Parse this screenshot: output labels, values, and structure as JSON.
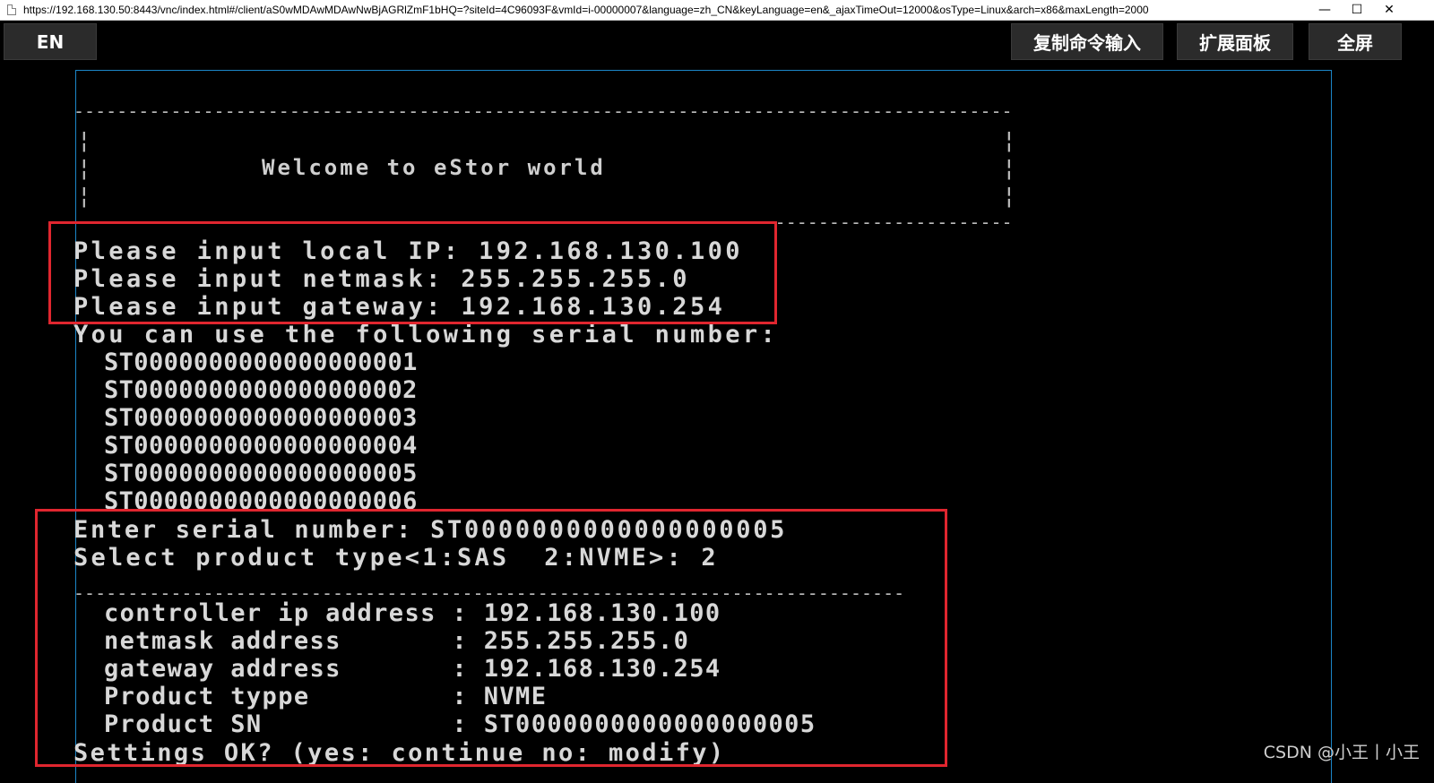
{
  "browser": {
    "url": "https://192.168.130.50:8443/vnc/index.html#/client/aS0wMDAwMDAwNwBjAGRlZmF1bHQ=?siteId=4C96093F&vmId=i-00000007&language=zh_CN&keyLanguage=en&_ajaxTimeOut=12000&osType=Linux&arch=x86&maxLength=2000",
    "minimize": "—",
    "maximize": "☐",
    "close": "✕"
  },
  "toolbar": {
    "language_label": "EN",
    "copy_command_label": "复制命令输入",
    "extend_panel_label": "扩展面板",
    "fullscreen_label": "全屏"
  },
  "console": {
    "welcome": "Welcome to eStor world",
    "ip_line": "Please input local IP: 192.168.130.100",
    "netmask_line": "Please input netmask: 255.255.255.0",
    "gateway_line": "Please input gateway: 192.168.130.254",
    "serial_intro": "You can use the following serial number:",
    "serials": [
      "ST0000000000000000001",
      "ST0000000000000000002",
      "ST0000000000000000003",
      "ST0000000000000000004",
      "ST0000000000000000005",
      "ST0000000000000000006"
    ],
    "enter_serial": "Enter serial number: ST0000000000000000005",
    "select_type": "Select product type<1:SAS  2:NVME>: 2",
    "summary": [
      "controller ip address : 192.168.130.100",
      "netmask address       : 255.255.255.0",
      "gateway address       : 192.168.130.254",
      "Product typpe         : NVME",
      "Product SN            : ST0000000000000000005"
    ],
    "confirm": "Settings OK? (yes: continue no: modify)"
  },
  "watermark": "CSDN @小王丨小王",
  "colors": {
    "highlight_box": "#e0262f",
    "console_border": "#1c86c8",
    "terminal_text": "#d8d8d8"
  }
}
